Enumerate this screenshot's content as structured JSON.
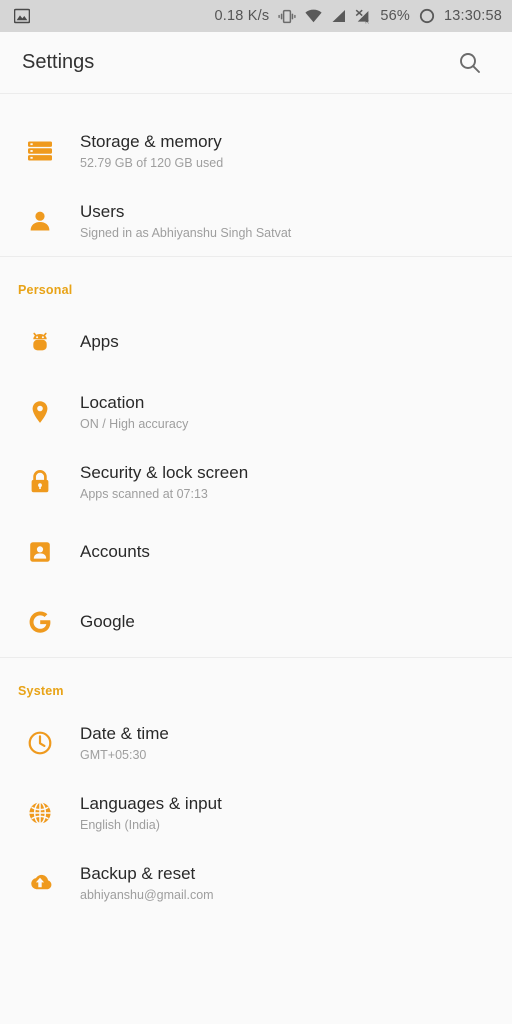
{
  "colors": {
    "accent": "#ef9a1e",
    "section_label": "#e8a317",
    "status_bg": "#d6d6d6",
    "page_bg": "#fafafa"
  },
  "statusbar": {
    "notification_icon": "image-screenshot-icon",
    "network_speed": "0.18 K/s",
    "vibrate_icon": "vibrate-icon",
    "wifi_icon": "wifi-icon",
    "signal_icon": "signal-bars-icon",
    "signal2_icon": "signal-no-service-roaming-icon",
    "battery_percent": "56%",
    "battery_icon": "battery-circle-icon",
    "clock": "13:30:58"
  },
  "appbar": {
    "title": "Settings",
    "search_icon": "search-icon"
  },
  "sections": [
    {
      "label": null,
      "items": [
        {
          "icon": "storage-icon",
          "title": "Storage & memory",
          "subtitle": "52.79 GB of 120 GB used"
        },
        {
          "icon": "user-icon",
          "title": "Users",
          "subtitle": "Signed in as Abhiyanshu Singh Satvat"
        }
      ]
    },
    {
      "label": "Personal",
      "items": [
        {
          "icon": "android-apps-icon",
          "title": "Apps",
          "subtitle": null
        },
        {
          "icon": "location-pin-icon",
          "title": "Location",
          "subtitle": "ON / High accuracy"
        },
        {
          "icon": "lock-icon",
          "title": "Security & lock screen",
          "subtitle": "Apps scanned at 07:13"
        },
        {
          "icon": "accounts-icon",
          "title": "Accounts",
          "subtitle": null
        },
        {
          "icon": "google-g-icon",
          "title": "Google",
          "subtitle": null
        }
      ]
    },
    {
      "label": "System",
      "items": [
        {
          "icon": "clock-icon",
          "title": "Date & time",
          "subtitle": "GMT+05:30"
        },
        {
          "icon": "globe-icon",
          "title": "Languages & input",
          "subtitle": "English (India)"
        },
        {
          "icon": "cloud-upload-icon",
          "title": "Backup & reset",
          "subtitle": "abhiyanshu@gmail.com"
        }
      ]
    }
  ]
}
